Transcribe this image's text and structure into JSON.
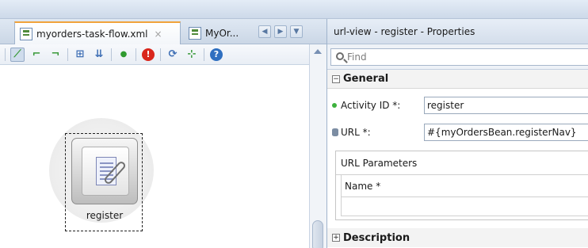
{
  "editor": {
    "tabs": [
      {
        "label": "myorders-task-flow.xml",
        "close": "×",
        "active": true
      },
      {
        "label": "MyOr...",
        "active": false
      }
    ],
    "nav_prev": "◀",
    "nav_next": "▶",
    "nav_list": "▼",
    "toolbar_icons": [
      "control-flow-icon",
      "wildcard-icon",
      "return-icon",
      "layout-icon",
      "align-icon",
      "dot-icon",
      "error-icon",
      "refresh-icon",
      "grid-icon",
      "help-icon"
    ],
    "node": {
      "label": "register",
      "icon": "url-view-icon"
    }
  },
  "properties": {
    "title": "url-view - register - Properties",
    "find_placeholder": "Find",
    "general_section": {
      "label": "General",
      "toggle": "−"
    },
    "activity_id": {
      "label": "Activity ID *:",
      "value": "register"
    },
    "url": {
      "label": "URL *:",
      "value": "#{myOrdersBean.registerNav}"
    },
    "url_parameters": {
      "title": "URL Parameters",
      "column_name": "Name *"
    },
    "description_section": {
      "label": "Description",
      "toggle": "+"
    }
  },
  "colors": {
    "active_tab_accent": "#f0a33b",
    "required_dot": "#3db13d",
    "error_icon": "#d9261c"
  }
}
